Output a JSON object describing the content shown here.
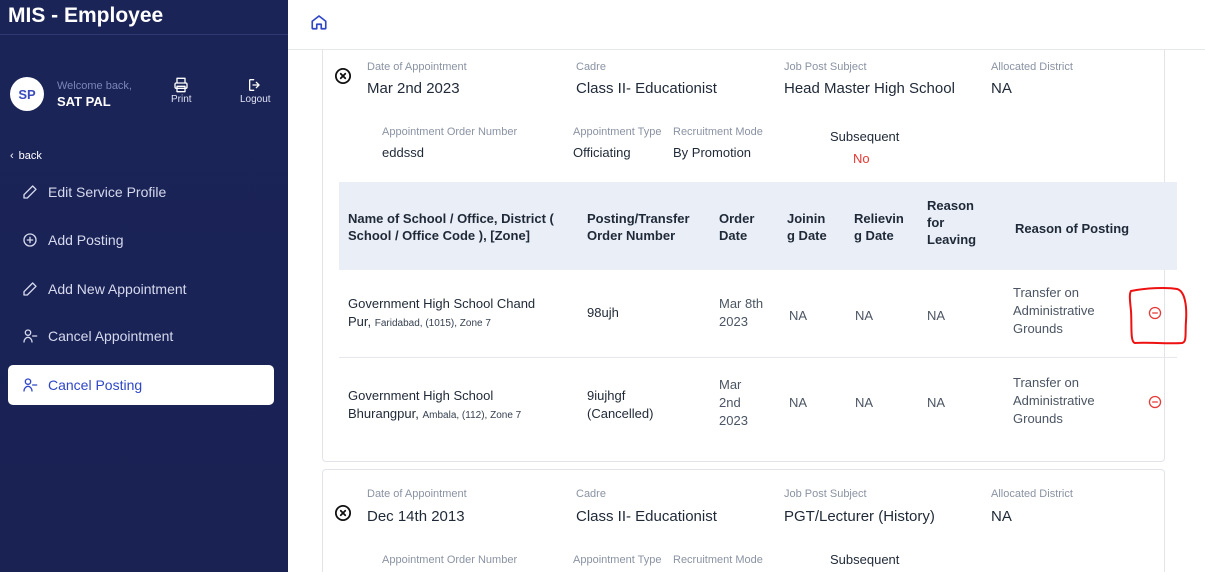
{
  "app": {
    "title": "MIS - Employee"
  },
  "user": {
    "initials": "SP",
    "welcome": "Welcome back,",
    "name": "SAT PAL"
  },
  "actions": {
    "print": "Print",
    "logout": "Logout"
  },
  "sidebar": {
    "back": "back",
    "items": [
      {
        "label": "Edit Service Profile",
        "icon": "pencil-icon"
      },
      {
        "label": "Add Posting",
        "icon": "plus-circle-icon"
      },
      {
        "label": "Add New Appointment",
        "icon": "pencil-icon"
      },
      {
        "label": "Cancel Appointment",
        "icon": "user-minus-icon"
      },
      {
        "label": "Cancel Posting",
        "icon": "user-minus-icon",
        "active": true
      }
    ]
  },
  "appointments": [
    {
      "date_label": "Date of Appointment",
      "date": "Mar 2nd 2023",
      "cadre_label": "Cadre",
      "cadre": "Class II- Educationist",
      "subject_label": "Job Post Subject",
      "subject": "Head Master High School",
      "district_label": "Allocated District",
      "district": "NA",
      "order_label": "Appointment Order Number",
      "order": "eddssd",
      "type_label": "Appointment Type",
      "type": "Officiating",
      "mode_label": "Recruitment Mode",
      "mode": "By Promotion",
      "subsequent_label": "Subsequent",
      "subsequent": "No"
    },
    {
      "date_label": "Date of Appointment",
      "date": "Dec 14th 2013",
      "cadre_label": "Cadre",
      "cadre": "Class II- Educationist",
      "subject_label": "Job Post Subject",
      "subject": "PGT/Lecturer (History)",
      "district_label": "Allocated District",
      "district": "NA",
      "order_label": "Appointment Order Number",
      "type_label": "Appointment Type",
      "mode_label": "Recruitment Mode",
      "subsequent_label": "Subsequent"
    }
  ],
  "postings_table": {
    "headers": {
      "school_l1": "Name of School / Office, District (",
      "school_l2": "School / Office Code ), [Zone]",
      "order_l1": "Posting/Transfer",
      "order_l2": "Order Number",
      "date_l1": "Order",
      "date_l2": "Date",
      "join_l1": "Joinin",
      "join_l2": "g Date",
      "relieve_l1": "Relievin",
      "relieve_l2": "g Date",
      "leave_l1": "Reason",
      "leave_l2": "for",
      "leave_l3": "Leaving",
      "posting_reason": "Reason of Posting"
    },
    "rows": [
      {
        "school_l1": "Government High School Chand",
        "school_l2": "Pur,",
        "school_small": "Faridabad, (1015), Zone 7",
        "order_l1": "98ujh",
        "date_l1": "Mar 8th",
        "date_l2": "2023",
        "joining": "NA",
        "relieving": "NA",
        "leaving": "NA",
        "reason_l1": "Transfer on",
        "reason_l2": "Administrative",
        "reason_l3": "Grounds"
      },
      {
        "school_l1": "Government High School",
        "school_l2": "Bhurangpur,",
        "school_small": "Ambala, (112), Zone 7",
        "order_l1": "9iujhgf",
        "order_l2": "(Cancelled)",
        "date_l1": "Mar",
        "date_l2": "2nd",
        "date_l3": "2023",
        "joining": "NA",
        "relieving": "NA",
        "leaving": "NA",
        "reason_l1": "Transfer on",
        "reason_l2": "Administrative",
        "reason_l3": "Grounds"
      }
    ]
  },
  "colors": {
    "sidebar_bg": "#1b2457",
    "accent": "#2f46c7",
    "danger": "#e53935",
    "table_header_bg": "#e9eef7"
  }
}
